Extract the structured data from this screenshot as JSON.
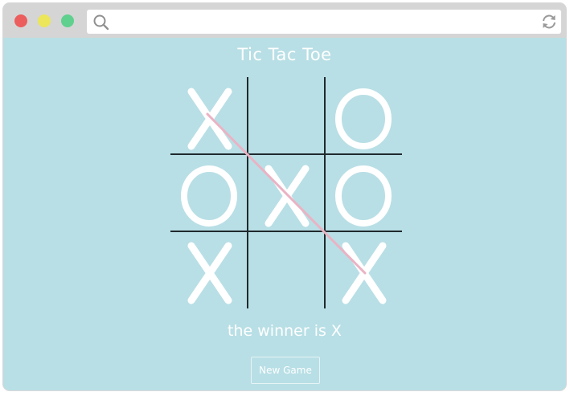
{
  "browser": {
    "traffic_lights": [
      {
        "name": "close",
        "color": "#ec5d5d"
      },
      {
        "name": "minimize",
        "color": "#ebe65a"
      },
      {
        "name": "maximize",
        "color": "#5fd08e"
      }
    ],
    "address": {
      "value": "",
      "placeholder": ""
    },
    "icons": {
      "search": "search-icon",
      "refresh": "refresh-icon"
    }
  },
  "game": {
    "title": "Tic Tac Toe",
    "board": [
      [
        "X",
        "",
        "O"
      ],
      [
        "O",
        "X",
        "O"
      ],
      [
        "X",
        "",
        "X"
      ]
    ],
    "winning_line": {
      "from": [
        0,
        0
      ],
      "to": [
        2,
        2
      ]
    },
    "status": "the winner is X",
    "new_game_label": "New Game"
  },
  "colors": {
    "background": "#b8dfe5",
    "grid": "#1f2a2e",
    "marks": "#ffffff",
    "win_line": "#eab3c4"
  }
}
